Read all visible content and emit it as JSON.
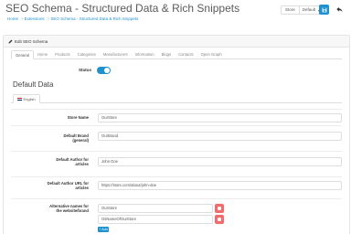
{
  "header": {
    "title": "SEO Schema - Structured Data & Rich Snippets",
    "breadcrumb": [
      "Home",
      "Extensions",
      "SEO Schema - Structured Data & Rich Snippets"
    ],
    "store_label": "Store",
    "store_value": "Default",
    "colors": {
      "primary": "#1e91cf",
      "danger": "#f56b6b"
    }
  },
  "panel": {
    "heading": "Edit SEO Schema",
    "tabs": [
      "General",
      "Home",
      "Products",
      "Categories",
      "Manufacturers",
      "Information",
      "Blogs",
      "Contacts",
      "Open Graph"
    ],
    "status_label": "Status",
    "status_on": true
  },
  "section": {
    "title": "Default Data",
    "language_tab": "English"
  },
  "fields": {
    "store_name": {
      "label": "Store Name",
      "value": "OurStore"
    },
    "default_brand": {
      "label": "Default Brand (general)",
      "value": "OurBrand"
    },
    "default_author": {
      "label": "Default Author for articles",
      "value": "John Doe"
    },
    "author_url": {
      "label": "Default Author URL for articles",
      "value": "https://store.com/about/john-doe"
    },
    "alt_names": {
      "label": "Alternative names for the website/brand",
      "values": [
        "OurStore",
        "OsNameOfOurStore"
      ],
      "add_label": "+ Add"
    }
  }
}
